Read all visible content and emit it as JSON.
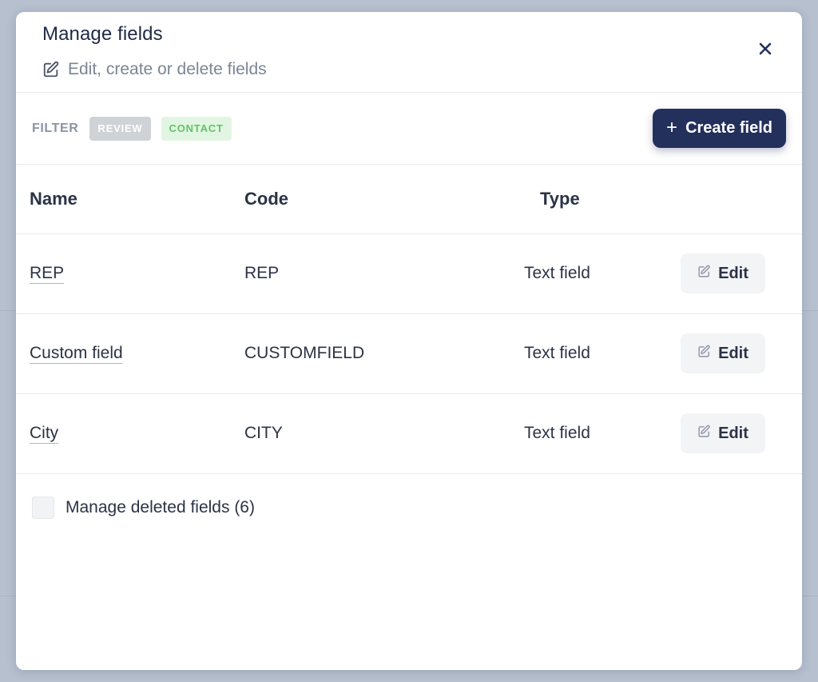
{
  "modal": {
    "title": "Manage fields",
    "subtitle": "Edit, create or delete fields"
  },
  "toolbar": {
    "filter_label": "FILTER",
    "filters": [
      "REVIEW",
      "CONTACT"
    ],
    "create_button_label": "Create field"
  },
  "table": {
    "headers": {
      "name": "Name",
      "code": "Code",
      "type": "Type"
    },
    "rows": [
      {
        "name": "REP",
        "code": "REP",
        "type": "Text field",
        "action": "Edit"
      },
      {
        "name": "Custom field",
        "code": "CUSTOMFIELD",
        "type": "Text field",
        "action": "Edit"
      },
      {
        "name": "City",
        "code": "CITY",
        "type": "Text field",
        "action": "Edit"
      }
    ]
  },
  "footer": {
    "manage_deleted_label": "Manage deleted fields (6)",
    "manage_deleted_checked": false
  },
  "colors": {
    "primary": "#23305c",
    "review_chip_bg": "#cfd2d6",
    "contact_chip_bg": "#e2f5e2",
    "contact_chip_text": "#63c26b"
  },
  "icons": {
    "subtitle_icon": "edit-square-icon",
    "close_icon": "close-icon",
    "create_icon": "plus-icon",
    "edit_icon": "edit-square-icon"
  }
}
